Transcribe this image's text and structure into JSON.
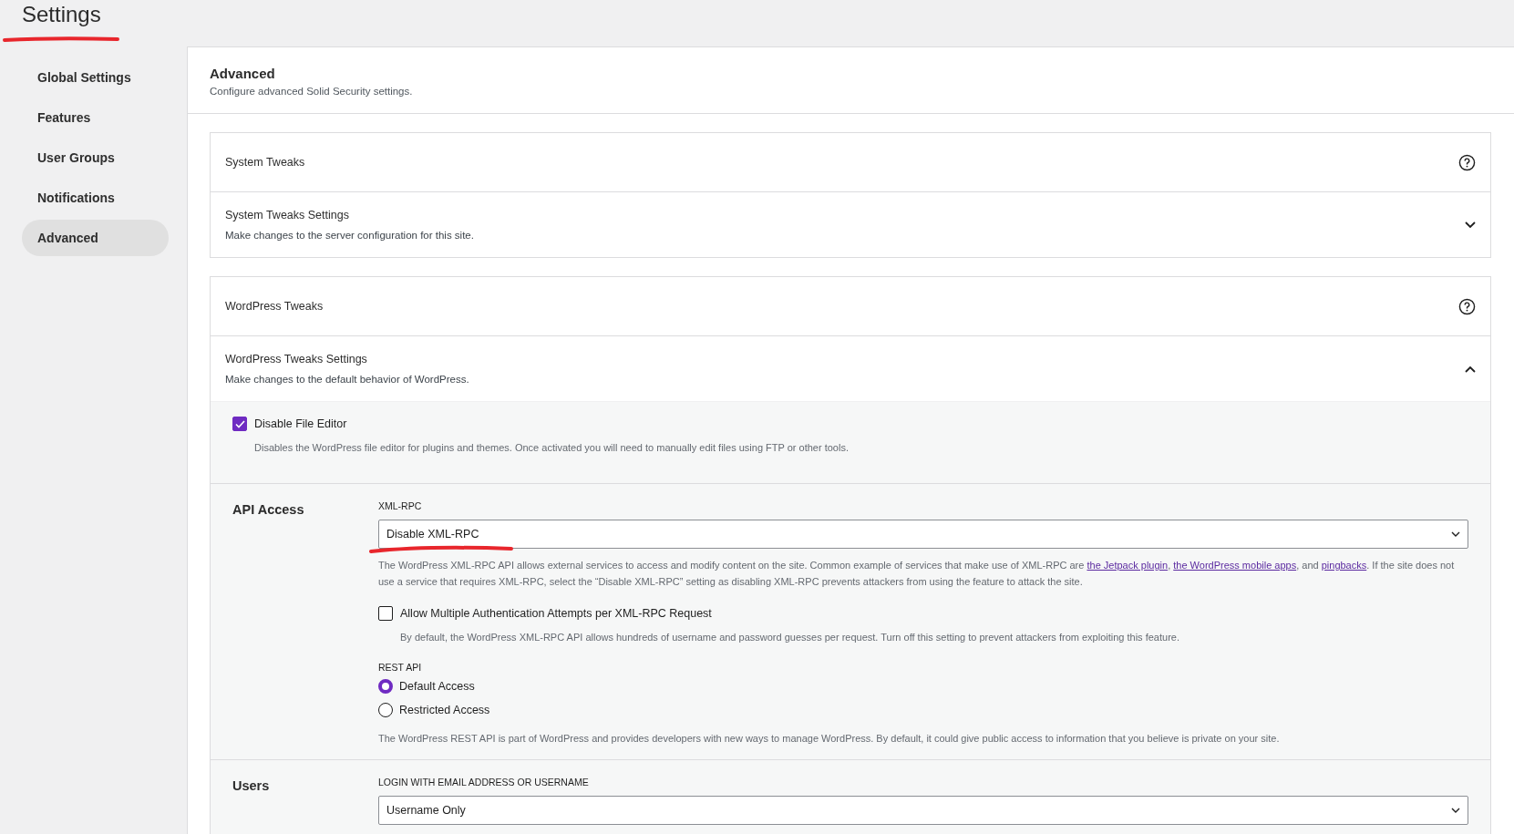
{
  "page_title": "Settings",
  "sidebar": {
    "items": [
      {
        "label": "Global Settings",
        "selected": false
      },
      {
        "label": "Features",
        "selected": false
      },
      {
        "label": "User Groups",
        "selected": false
      },
      {
        "label": "Notifications",
        "selected": false
      },
      {
        "label": "Advanced",
        "selected": true
      }
    ]
  },
  "header": {
    "title": "Advanced",
    "subtitle": "Configure advanced Solid Security settings."
  },
  "cards": [
    {
      "title": "System Tweaks",
      "settings_title": "System Tweaks Settings",
      "settings_description": "Make changes to the server configuration for this site.",
      "expanded": false
    },
    {
      "title": "WordPress Tweaks",
      "settings_title": "WordPress Tweaks Settings",
      "settings_description": "Make changes to the default behavior of WordPress.",
      "expanded": true,
      "file_editor": {
        "label": "Disable File Editor",
        "checked": true,
        "description": "Disables the WordPress file editor for plugins and themes. Once activated you will need to manually edit files using FTP or other tools."
      },
      "sections": [
        {
          "title": "API Access",
          "fields": [
            {
              "kind": "select",
              "label": "XML-RPC",
              "value": "Disable XML-RPC",
              "description_parts": [
                {
                  "kind": "text",
                  "text": "The WordPress XML-RPC API allows external services to access and modify content on the site. Common example of services that make use of XML-RPC are "
                },
                {
                  "kind": "link",
                  "text": "the Jetpack plugin"
                },
                {
                  "kind": "text",
                  "text": ", "
                },
                {
                  "kind": "link",
                  "text": "the WordPress mobile apps"
                },
                {
                  "kind": "text",
                  "text": ", and "
                },
                {
                  "kind": "link",
                  "text": "pingbacks"
                },
                {
                  "kind": "text",
                  "text": ". If the site does not use a service that requires XML-RPC, select the “Disable XML-RPC” setting as disabling XML-RPC prevents attackers from using the feature to attack the site."
                }
              ]
            },
            {
              "kind": "checkbox",
              "label": "Allow Multiple Authentication Attempts per XML-RPC Request",
              "checked": false,
              "description": "By default, the WordPress XML-RPC API allows hundreds of username and password guesses per request. Turn off this setting to prevent attackers from exploiting this feature."
            },
            {
              "kind": "radio",
              "label": "REST API",
              "options": [
                {
                  "label": "Default Access",
                  "selected": true
                },
                {
                  "label": "Restricted Access",
                  "selected": false
                }
              ],
              "description": "The WordPress REST API is part of WordPress and provides developers with new ways to manage WordPress. By default, it could give public access to information that you believe is private on your site."
            }
          ]
        },
        {
          "title": "Users",
          "fields": [
            {
              "kind": "select",
              "label": "LOGIN WITH EMAIL ADDRESS OR USERNAME",
              "value": "Username Only"
            }
          ]
        }
      ]
    }
  ]
}
